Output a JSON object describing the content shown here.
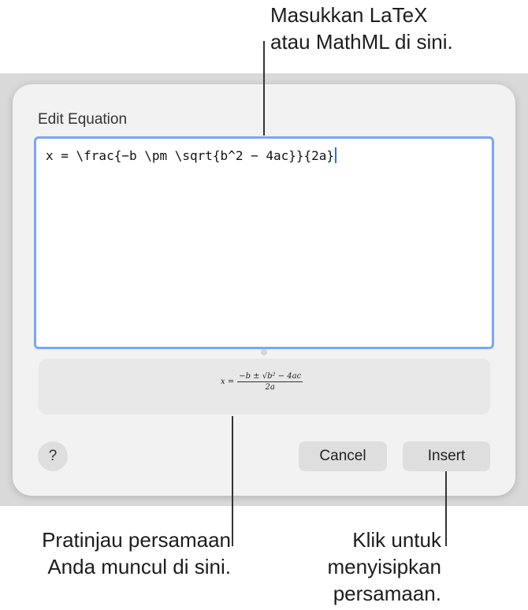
{
  "callouts": {
    "top": [
      "Masukkan LaTeX",
      "atau MathML di sini."
    ],
    "preview": [
      "Pratinjau persamaan",
      "Anda muncul di sini."
    ],
    "insert": [
      "Klik untuk",
      "menyisipkan",
      "persamaan."
    ]
  },
  "dialog": {
    "title": "Edit Equation",
    "input_value": "x = \\frac{−b \\pm \\sqrt{b^2 − 4ac}}{2a}",
    "help_label": "?",
    "cancel_label": "Cancel",
    "insert_label": "Insert"
  },
  "preview_eq": {
    "lhs": "x =",
    "numerator": "−b ± √b² − 4ac",
    "denominator": "2a"
  },
  "colors": {
    "accent": "#7aa6f5",
    "dialog_bg": "#f2f2f2",
    "button_bg": "#dedede"
  }
}
